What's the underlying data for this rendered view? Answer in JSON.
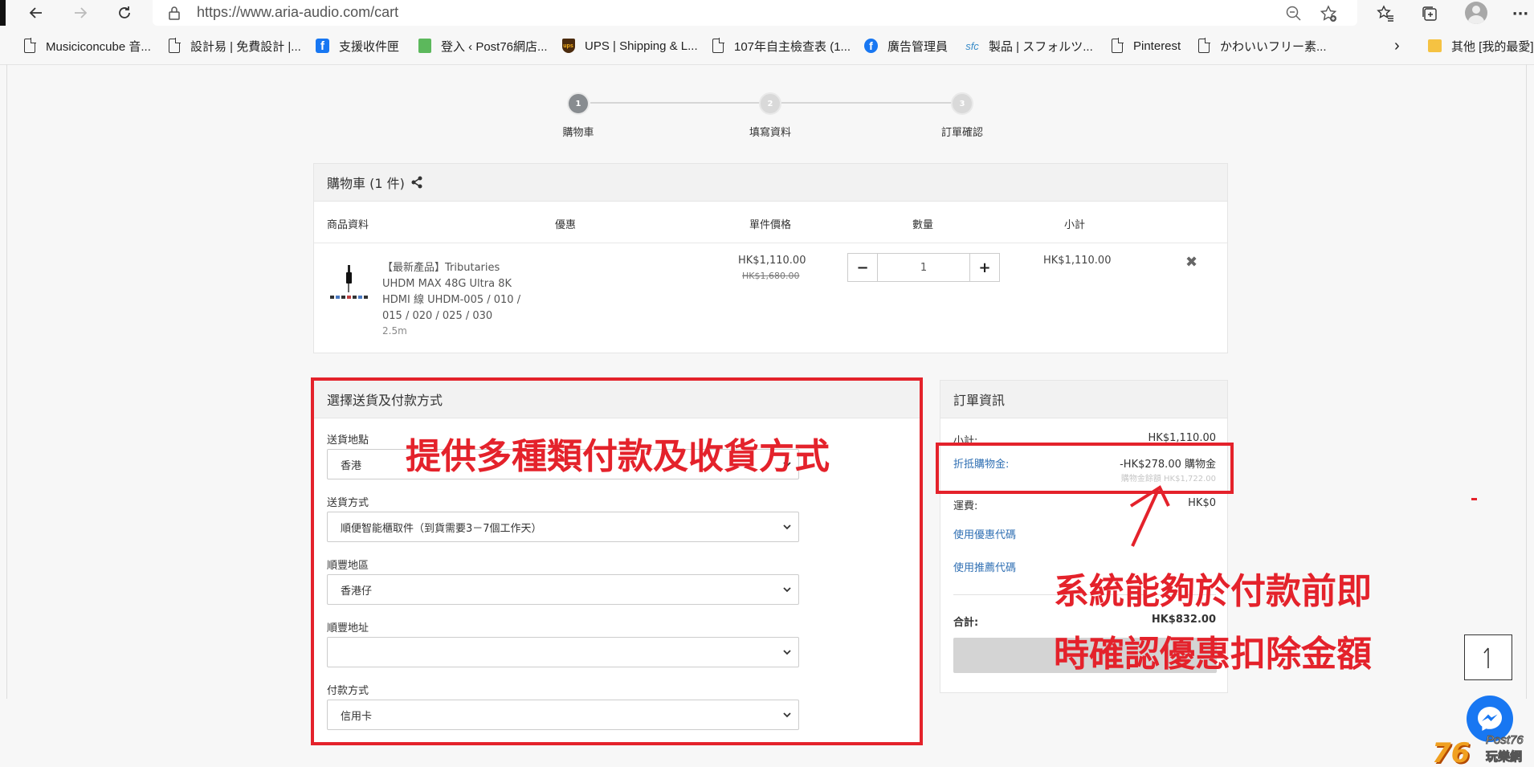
{
  "browser": {
    "url": "https://www.aria-audio.com/cart",
    "bookmarks": [
      {
        "label": "Musiciconcube 音...",
        "icon": "document-icon"
      },
      {
        "label": "設計易 | 免費設計 |...",
        "icon": "document-icon"
      },
      {
        "label": "支援收件匣",
        "icon": "facebook-icon"
      },
      {
        "label": "登入 ‹ Post76網店...",
        "icon": "post76-icon"
      },
      {
        "label": "UPS | Shipping & L...",
        "icon": "ups-icon"
      },
      {
        "label": "107年自主檢查表 (1...",
        "icon": "document-icon"
      },
      {
        "label": "廣告管理員",
        "icon": "facebook-icon"
      },
      {
        "label": "製品 | スフォルツ...",
        "icon": "sfc-icon"
      },
      {
        "label": "Pinterest",
        "icon": "document-icon"
      },
      {
        "label": "かわいいフリー素...",
        "icon": "document-icon"
      }
    ],
    "other_bookmarks": "其他 [我的最愛]"
  },
  "steps": [
    {
      "num": "1",
      "label": "購物車"
    },
    {
      "num": "2",
      "label": "填寫資料"
    },
    {
      "num": "3",
      "label": "訂單確認"
    }
  ],
  "cart": {
    "title": "購物車 (1 件)",
    "columns": {
      "product": "商品資料",
      "offer": "優惠",
      "unit_price": "單件價格",
      "qty": "數量",
      "subtotal": "小計"
    },
    "item": {
      "name": "【最新產品】Tributaries UHDM MAX 48G Ultra 8K HDMI 線 UHDM-005 / 010 / 015 / 020 / 025 / 030",
      "variant": "2.5m",
      "price": "HK$1,110.00",
      "original_price": "HK$1,680.00",
      "qty": "1",
      "subtotal": "HK$1,110.00"
    }
  },
  "delivery": {
    "title": "選擇送貨及付款方式",
    "fields": [
      {
        "label": "送貨地點",
        "value": "香港"
      },
      {
        "label": "送貨方式",
        "value": "順便智能櫃取件（到貨需要3－7個工作天）"
      },
      {
        "label": "順豐地區",
        "value": "香港仔"
      },
      {
        "label": "順豐地址",
        "value": ""
      },
      {
        "label": "付款方式",
        "value": "信用卡"
      }
    ]
  },
  "summary": {
    "title": "訂單資訊",
    "subtotal_label": "小計:",
    "subtotal_value": "HK$1,110.00",
    "credit_label": "折抵購物金:",
    "credit_value": "-HK$278.00 購物金",
    "credit_balance_label": "購物金餘額",
    "credit_balance_value": "HK$1,722.00",
    "shipping_label": "運費:",
    "shipping_value": "HK$0",
    "coupon_link": "使用優惠代碼",
    "referral_link": "使用推薦代碼",
    "total_label": "合計:",
    "total_value": "HK$832.00"
  },
  "annotations": {
    "left": "提供多種類付款及收貨方式",
    "right_line1": "系統能夠於付款前即",
    "right_line2": "時確認優惠扣除金額"
  },
  "watermark": {
    "num": "76",
    "brand": "Post76",
    "zh": "玩樂網"
  },
  "colors": {
    "annotation_red": "#e4222b",
    "link_blue": "#2f6fb3",
    "step_active": "#888c90"
  }
}
